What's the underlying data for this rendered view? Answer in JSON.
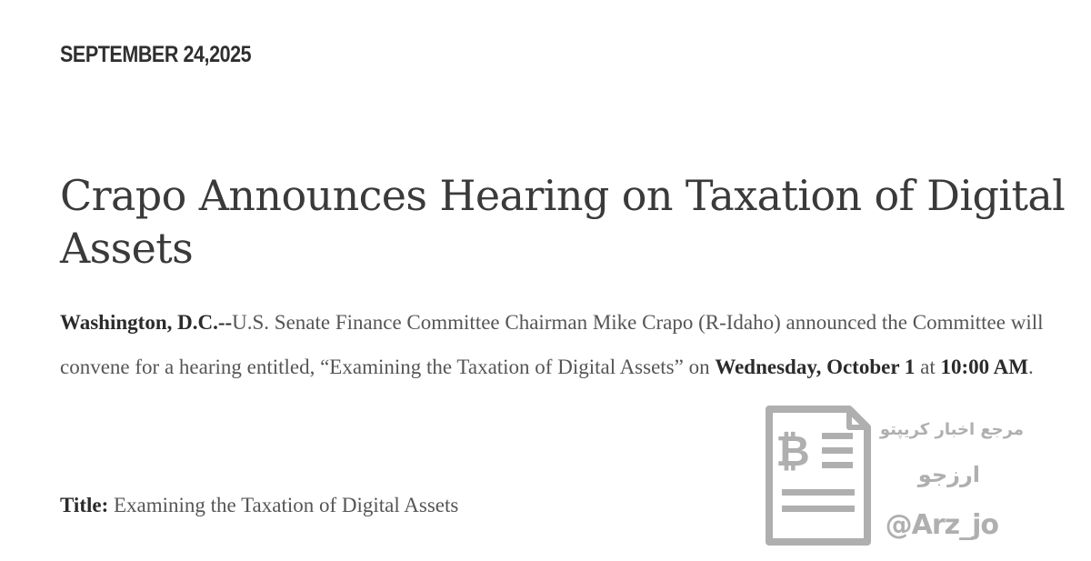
{
  "article": {
    "date": "SEPTEMBER 24,2025",
    "headline": "Crapo Announces Hearing on Taxation of Digital Assets",
    "dateline": "Washington, D.C.--",
    "body_part1": "U.S. Senate Finance Committee Chairman Mike Crapo (R-Idaho) announced the Committee will convene for a hearing entitled, “Examining the Taxation of Digital Assets” on ",
    "hearing_day": "Wednesday, October 1",
    "body_at": " at ",
    "hearing_time": "10:00 AM",
    "body_end": ".",
    "title_label": "Title:",
    "title_value": " Examining the Taxation of Digital Assets"
  },
  "watermark": {
    "line1": "مرجع اخبار کریپتو",
    "line2": "ارزجو",
    "line3": "@Arz_jo",
    "icon": "bitcoin-document-icon",
    "color": "#7a7a7a"
  }
}
